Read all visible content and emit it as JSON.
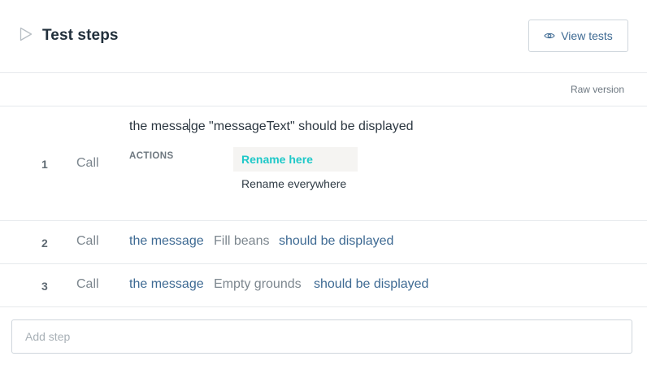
{
  "header": {
    "title": "Test steps",
    "view_tests_label": "View tests",
    "raw_version_label": "Raw version"
  },
  "editing_step": {
    "number": "1",
    "keyword": "Call",
    "text_before_caret": "the messa",
    "text_after_caret": "ge \"messageText\" should be displayed",
    "actions_label": "ACTIONS",
    "actions": [
      "Rename here",
      "Rename everywhere"
    ]
  },
  "steps": [
    {
      "number": "2",
      "keyword": "Call",
      "segments": [
        {
          "text": "the message",
          "kind": "link"
        },
        {
          "text": "Fill beans",
          "kind": "param"
        },
        {
          "text": "should be displayed",
          "kind": "link"
        }
      ]
    },
    {
      "number": "3",
      "keyword": "Call",
      "segments": [
        {
          "text": "the message",
          "kind": "link"
        },
        {
          "text": "Empty grounds",
          "kind": "param"
        },
        {
          "text": "should be displayed",
          "kind": "link"
        }
      ]
    }
  ],
  "add_step": {
    "placeholder": "Add step"
  },
  "colors": {
    "link": "#3e6a93",
    "param": "#7c868e",
    "accent": "#1ec8c8"
  },
  "icons": {
    "title": "play-icon",
    "view_tests": "eye-icon"
  }
}
